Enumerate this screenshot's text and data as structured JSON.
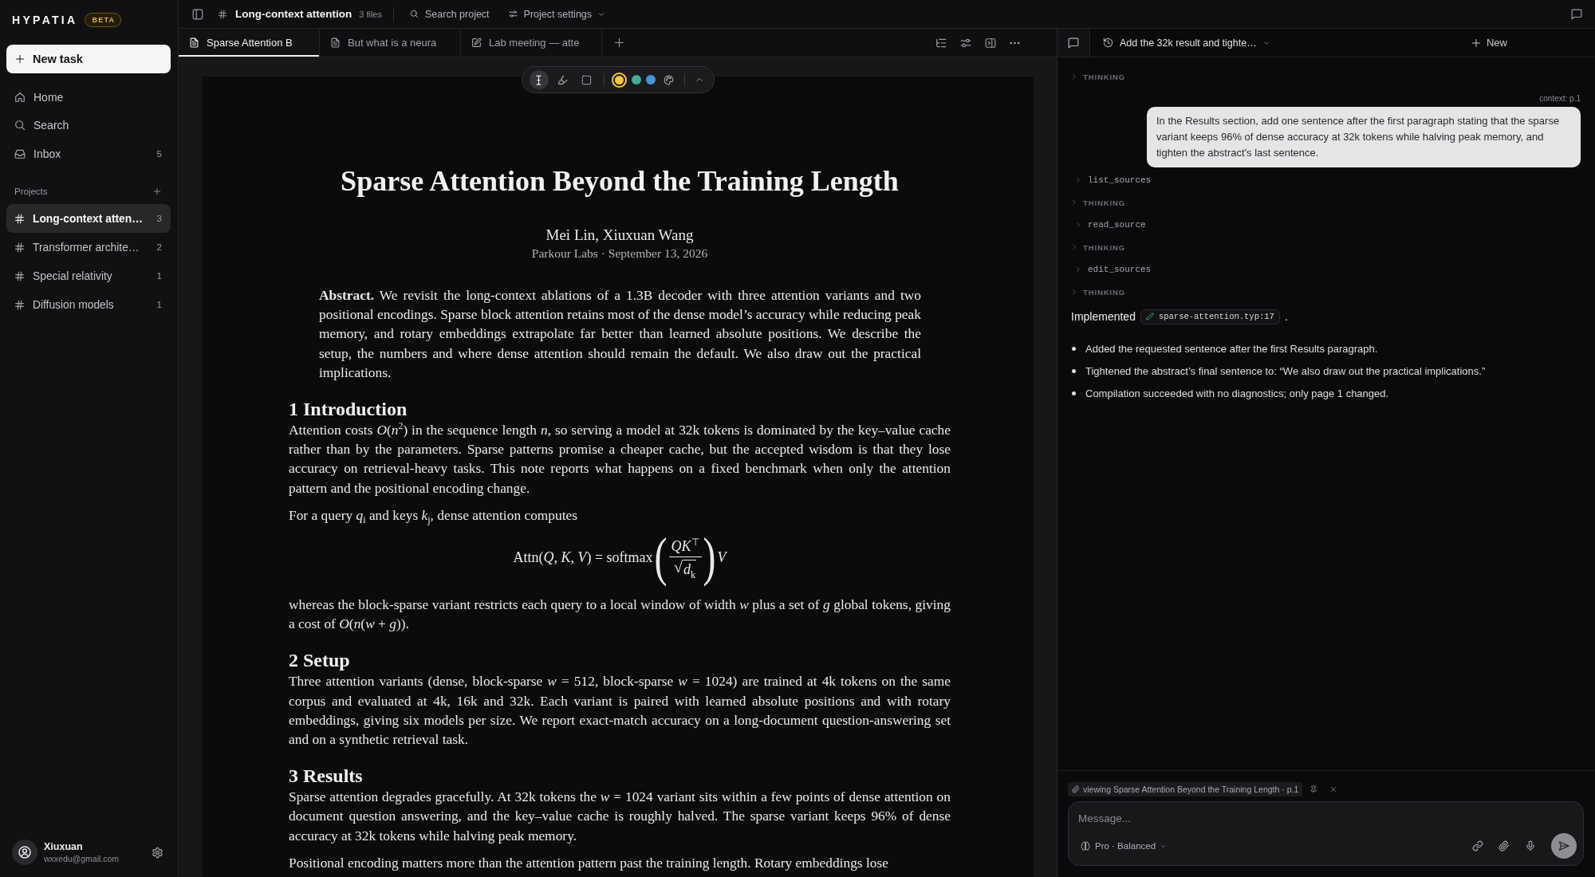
{
  "sidebar": {
    "logo": "HYPATIA",
    "badge": "BETA",
    "new_task": "New task",
    "nav": [
      {
        "kind": "home",
        "label": "Home",
        "selected": false
      },
      {
        "kind": "search",
        "label": "Search",
        "selected": false
      },
      {
        "kind": "inbox",
        "label": "Inbox",
        "count": "5",
        "selected": false
      }
    ],
    "projects_heading": "Projects",
    "projects": [
      {
        "name": "Long-context atten…",
        "count": "3",
        "selected": true
      },
      {
        "name": "Transformer archite…",
        "count": "2",
        "selected": false
      },
      {
        "name": "Special relativity",
        "count": "1",
        "selected": false
      },
      {
        "name": "Diffusion models",
        "count": "1",
        "selected": false
      }
    ],
    "user": {
      "name": "Xiuxuan",
      "email": "wxxedu@gmail.com"
    }
  },
  "topbar": {
    "project": "Long-context attention",
    "file_count": "3 files",
    "search": "Search project",
    "settings": "Project settings"
  },
  "tabs": [
    {
      "kind": "document",
      "label": "Sparse Attention B",
      "selected": true
    },
    {
      "kind": "document",
      "label": "But what is a neura",
      "selected": false
    },
    {
      "kind": "note",
      "label": "Lab meeting — atte",
      "selected": false
    }
  ],
  "annotation_toolbar": {
    "tools": [
      {
        "kind": "text",
        "selected": true
      },
      {
        "kind": "highlight",
        "selected": false
      },
      {
        "kind": "select",
        "selected": false
      }
    ],
    "colors": [
      {
        "color": "#f4c542",
        "selected": true
      },
      {
        "color": "#3fae92",
        "selected": false
      },
      {
        "color": "#4a95d6",
        "selected": false
      }
    ]
  },
  "document": {
    "title": "Sparse Attention Beyond the Training Length",
    "authors": "Mei Lin, Xiuxuan Wang",
    "affiliation": "Parkour Labs · September 13, 2026",
    "abstract": "**Abstract.** We revisit the long-context ablations of a 1.3B decoder with three attention variants and two positional encodings. Sparse block attention retains most of the dense model’s accuracy while reducing peak memory, and rotary embeddings extrapolate far better than learned absolute positions. We describe the setup, the numbers and where dense attention should remain the default. We also draw out the practical implications.",
    "sections": [
      {
        "heading": "1 Introduction",
        "blocks": [
          {
            "kind": "paragraph",
            "text": "Attention costs *O*(*n*$^{2}$) in the sequence length *n*, so serving a model at 32k tokens is dominated by the key–value cache rather than by the parameters. Sparse patterns promise a cheaper cache, but the accepted wisdom is that they lose accuracy on retrieval-heavy tasks. This note reports what happens on a fixed benchmark when only the attention pattern and the positional encoding change."
          },
          {
            "kind": "paragraph",
            "text": "For a query *q*$_{i}$ and keys *k*$_{j}$, dense attention computes"
          },
          {
            "kind": "equation",
            "left": "Attn(*Q*, *K*, *V*) = softmax",
            "open": "(",
            "numerator": "*QK*$^{⊤}$",
            "radical": "√",
            "denominator": "*d*$_{k}$",
            "close": ")",
            "right": "*V*"
          },
          {
            "kind": "paragraph",
            "text": "whereas the block-sparse variant restricts each query to a local window of width *w* plus a set of *g* global tokens, giving a cost of *O*(*n*(*w* + *g*))."
          }
        ]
      },
      {
        "heading": "2 Setup",
        "blocks": [
          {
            "kind": "paragraph",
            "text": "Three attention variants (dense, block-sparse *w* = 512, block-sparse *w* = 1024) are trained at 4k tokens on the same corpus and evaluated at 4k, 16k and 32k. Each variant is paired with learned absolute positions and with rotary embeddings, giving six models per size. We report exact-match accuracy on a long-document question-answering set and on a synthetic retrieval task."
          }
        ]
      },
      {
        "heading": "3 Results",
        "blocks": [
          {
            "kind": "paragraph",
            "text": "Sparse attention degrades gracefully. At 32k tokens the *w* = 1024 variant sits within a few points of dense attention on document question answering, and the key–value cache is roughly halved. The sparse variant keeps 96% of dense accuracy at 32k tokens while halving peak memory."
          },
          {
            "kind": "paragraph",
            "text": "Positional encoding matters more than the attention pattern past the training length. Rotary embeddings lose"
          }
        ]
      }
    ]
  },
  "chat": {
    "thread": "Add the 32k result and tighte…",
    "new_label": "New",
    "items": [
      {
        "kind": "thinking",
        "label": "THINKING",
        "expanded": false
      },
      {
        "kind": "user",
        "context": "context: p.1",
        "text": "In the Results section, add one sentence after the first paragraph stating that the sparse variant keeps 96% of dense accuracy at 32k tokens while halving peak memory, and tighten the abstract's last sentence."
      },
      {
        "kind": "tool",
        "label": "list_sources",
        "expanded": false
      },
      {
        "kind": "thinking",
        "label": "THINKING",
        "expanded": false
      },
      {
        "kind": "tool",
        "label": "read_source",
        "expanded": false
      },
      {
        "kind": "thinking",
        "label": "THINKING",
        "expanded": false
      },
      {
        "kind": "tool",
        "label": "edit_sources",
        "expanded": false
      },
      {
        "kind": "thinking",
        "label": "THINKING",
        "expanded": false
      },
      {
        "kind": "reply",
        "lead": "Implemented",
        "file": "sparse-attention.typ:17",
        "tail": ".",
        "bullets": [
          "Added the requested sentence after the first Results paragraph.",
          "Tightened the abstract’s final sentence to: “We also draw out the practical implications.”",
          "Compilation succeeded with no diagnostics; only page 1 changed."
        ]
      }
    ],
    "context_chip": "viewing Sparse Attention Beyond the Training Length · p.1",
    "composer": {
      "placeholder": "Message...",
      "model": "Pro · Balanced"
    }
  }
}
